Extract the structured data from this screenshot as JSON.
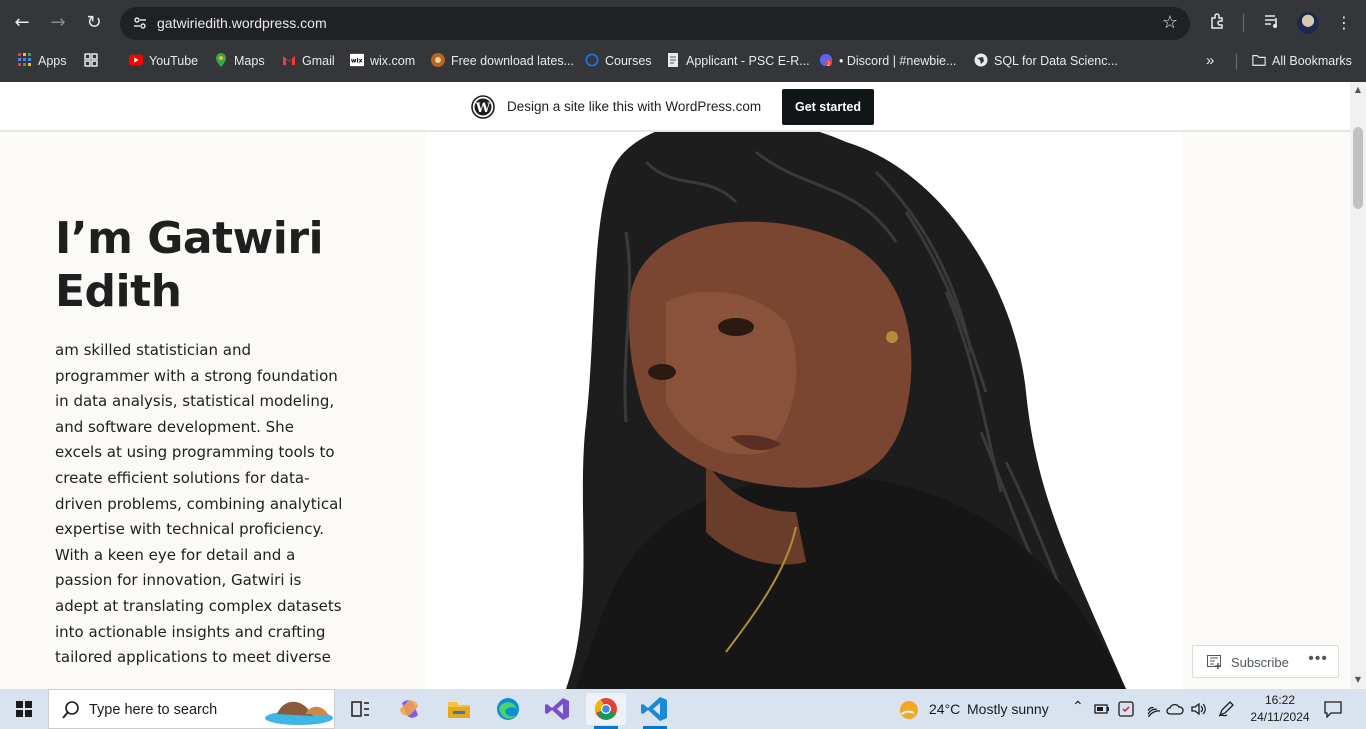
{
  "browser": {
    "url": "gatwiriedith.wordpress.com",
    "bookmarks": [
      {
        "label": "Apps",
        "icon": "apps-grid-icon"
      },
      {
        "label": "",
        "icon": "tab-grid-icon"
      },
      {
        "label": "YouTube",
        "icon": "youtube-icon"
      },
      {
        "label": "Maps",
        "icon": "maps-icon"
      },
      {
        "label": "Gmail",
        "icon": "gmail-icon"
      },
      {
        "label": "wix.com",
        "icon": "wix-icon"
      },
      {
        "label": "Free download lates...",
        "icon": "download-site-icon"
      },
      {
        "label": "Courses",
        "icon": "courses-icon"
      },
      {
        "label": "Applicant - PSC E-R...",
        "icon": "document-icon"
      },
      {
        "label": "• Discord | #newbie...",
        "icon": "discord-icon"
      },
      {
        "label": "SQL for Data Scienc...",
        "icon": "globe-icon"
      }
    ],
    "all_bookmarks": "All Bookmarks"
  },
  "wp_banner": {
    "text": "Design a site like this with WordPress.com",
    "button": "Get started"
  },
  "hero": {
    "title": "I’m Gatwiri Edith",
    "bio": "am skilled statistician and programmer with a strong foundation in data analysis, statistical modeling, and software development. She excels at using programming tools to create efficient solutions for data-driven problems, combining analytical expertise with technical proficiency. With a keen eye for detail and a passion for innovation, Gatwiri is adept at translating complex datasets into actionable insights and crafting tailored applications to meet diverse"
  },
  "subscribe": {
    "label": "Subscribe",
    "more": "•••"
  },
  "taskbar": {
    "search_placeholder": "Type here to search",
    "weather_temp": "24°C",
    "weather_desc": "Mostly sunny",
    "time": "16:22",
    "date": "24/11/2024"
  },
  "colors": {
    "chrome_bg": "#35363a",
    "page_bg": "#fbfaf7",
    "accent": "#0078d4",
    "wp_button": "#101517"
  }
}
